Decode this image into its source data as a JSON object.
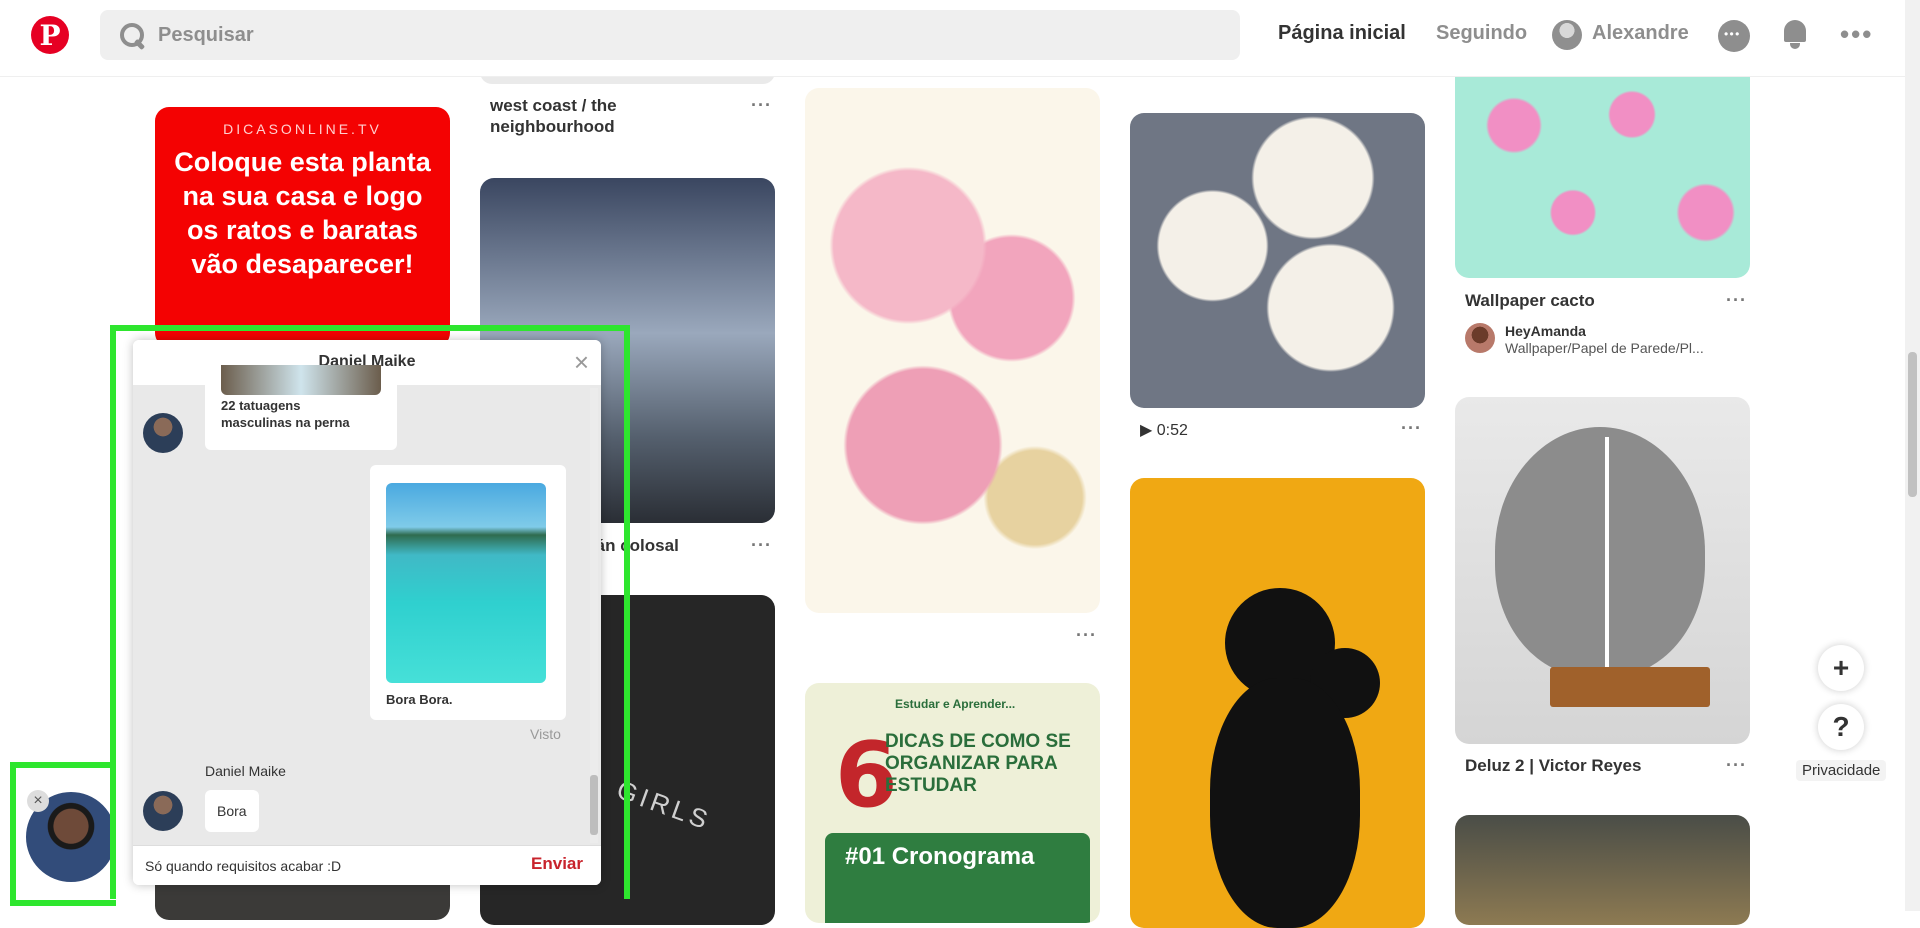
{
  "header": {
    "logo": "P",
    "search_placeholder": "Pesquisar",
    "nav_home": "Página inicial",
    "nav_following": "Seguindo",
    "user_name": "Alexandre",
    "more": "•••"
  },
  "pins": {
    "red": {
      "source": "DICASONLINE.TV",
      "text": "Coloque esta planta na sua casa e logo os ratos e baratas vão desaparecer!"
    },
    "westcoast": {
      "title": "west coast / the neighbourhood"
    },
    "colossal": {
      "title": "tán colosal"
    },
    "video": {
      "duration": "0:52"
    },
    "cactus": {
      "title": "Wallpaper cacto",
      "user": "HeyAmanda",
      "board": "Wallpaper/Papel de Parede/Pl..."
    },
    "deluz": {
      "title": "Deluz 2 | Victor Reyes"
    },
    "study": {
      "brand": "Estudar e Aprender...",
      "number": "6",
      "headline": "DICAS DE COMO SE ORGANIZAR PARA ESTUDAR",
      "section": "#01 Cronograma"
    },
    "girls": {
      "text": "GIRLS"
    }
  },
  "more_dots": "···",
  "fab": {
    "plus": "+",
    "help": "?",
    "privacy": "Privacidade"
  },
  "chat": {
    "title": "Daniel Maike",
    "close": "×",
    "msg1_text": "22 tatuagens masculinas na perna",
    "msg2_caption": "Bora Bora.",
    "seen": "Visto",
    "sender": "Daniel Maike",
    "msg3_text": "Bora",
    "input_value": "Só quando requisitos acabar :D",
    "send": "Enviar",
    "bubble_close": "×"
  },
  "colors": {
    "brand_red": "#e60023",
    "highlight": "#2ee62e",
    "send_red": "#c8232c"
  }
}
